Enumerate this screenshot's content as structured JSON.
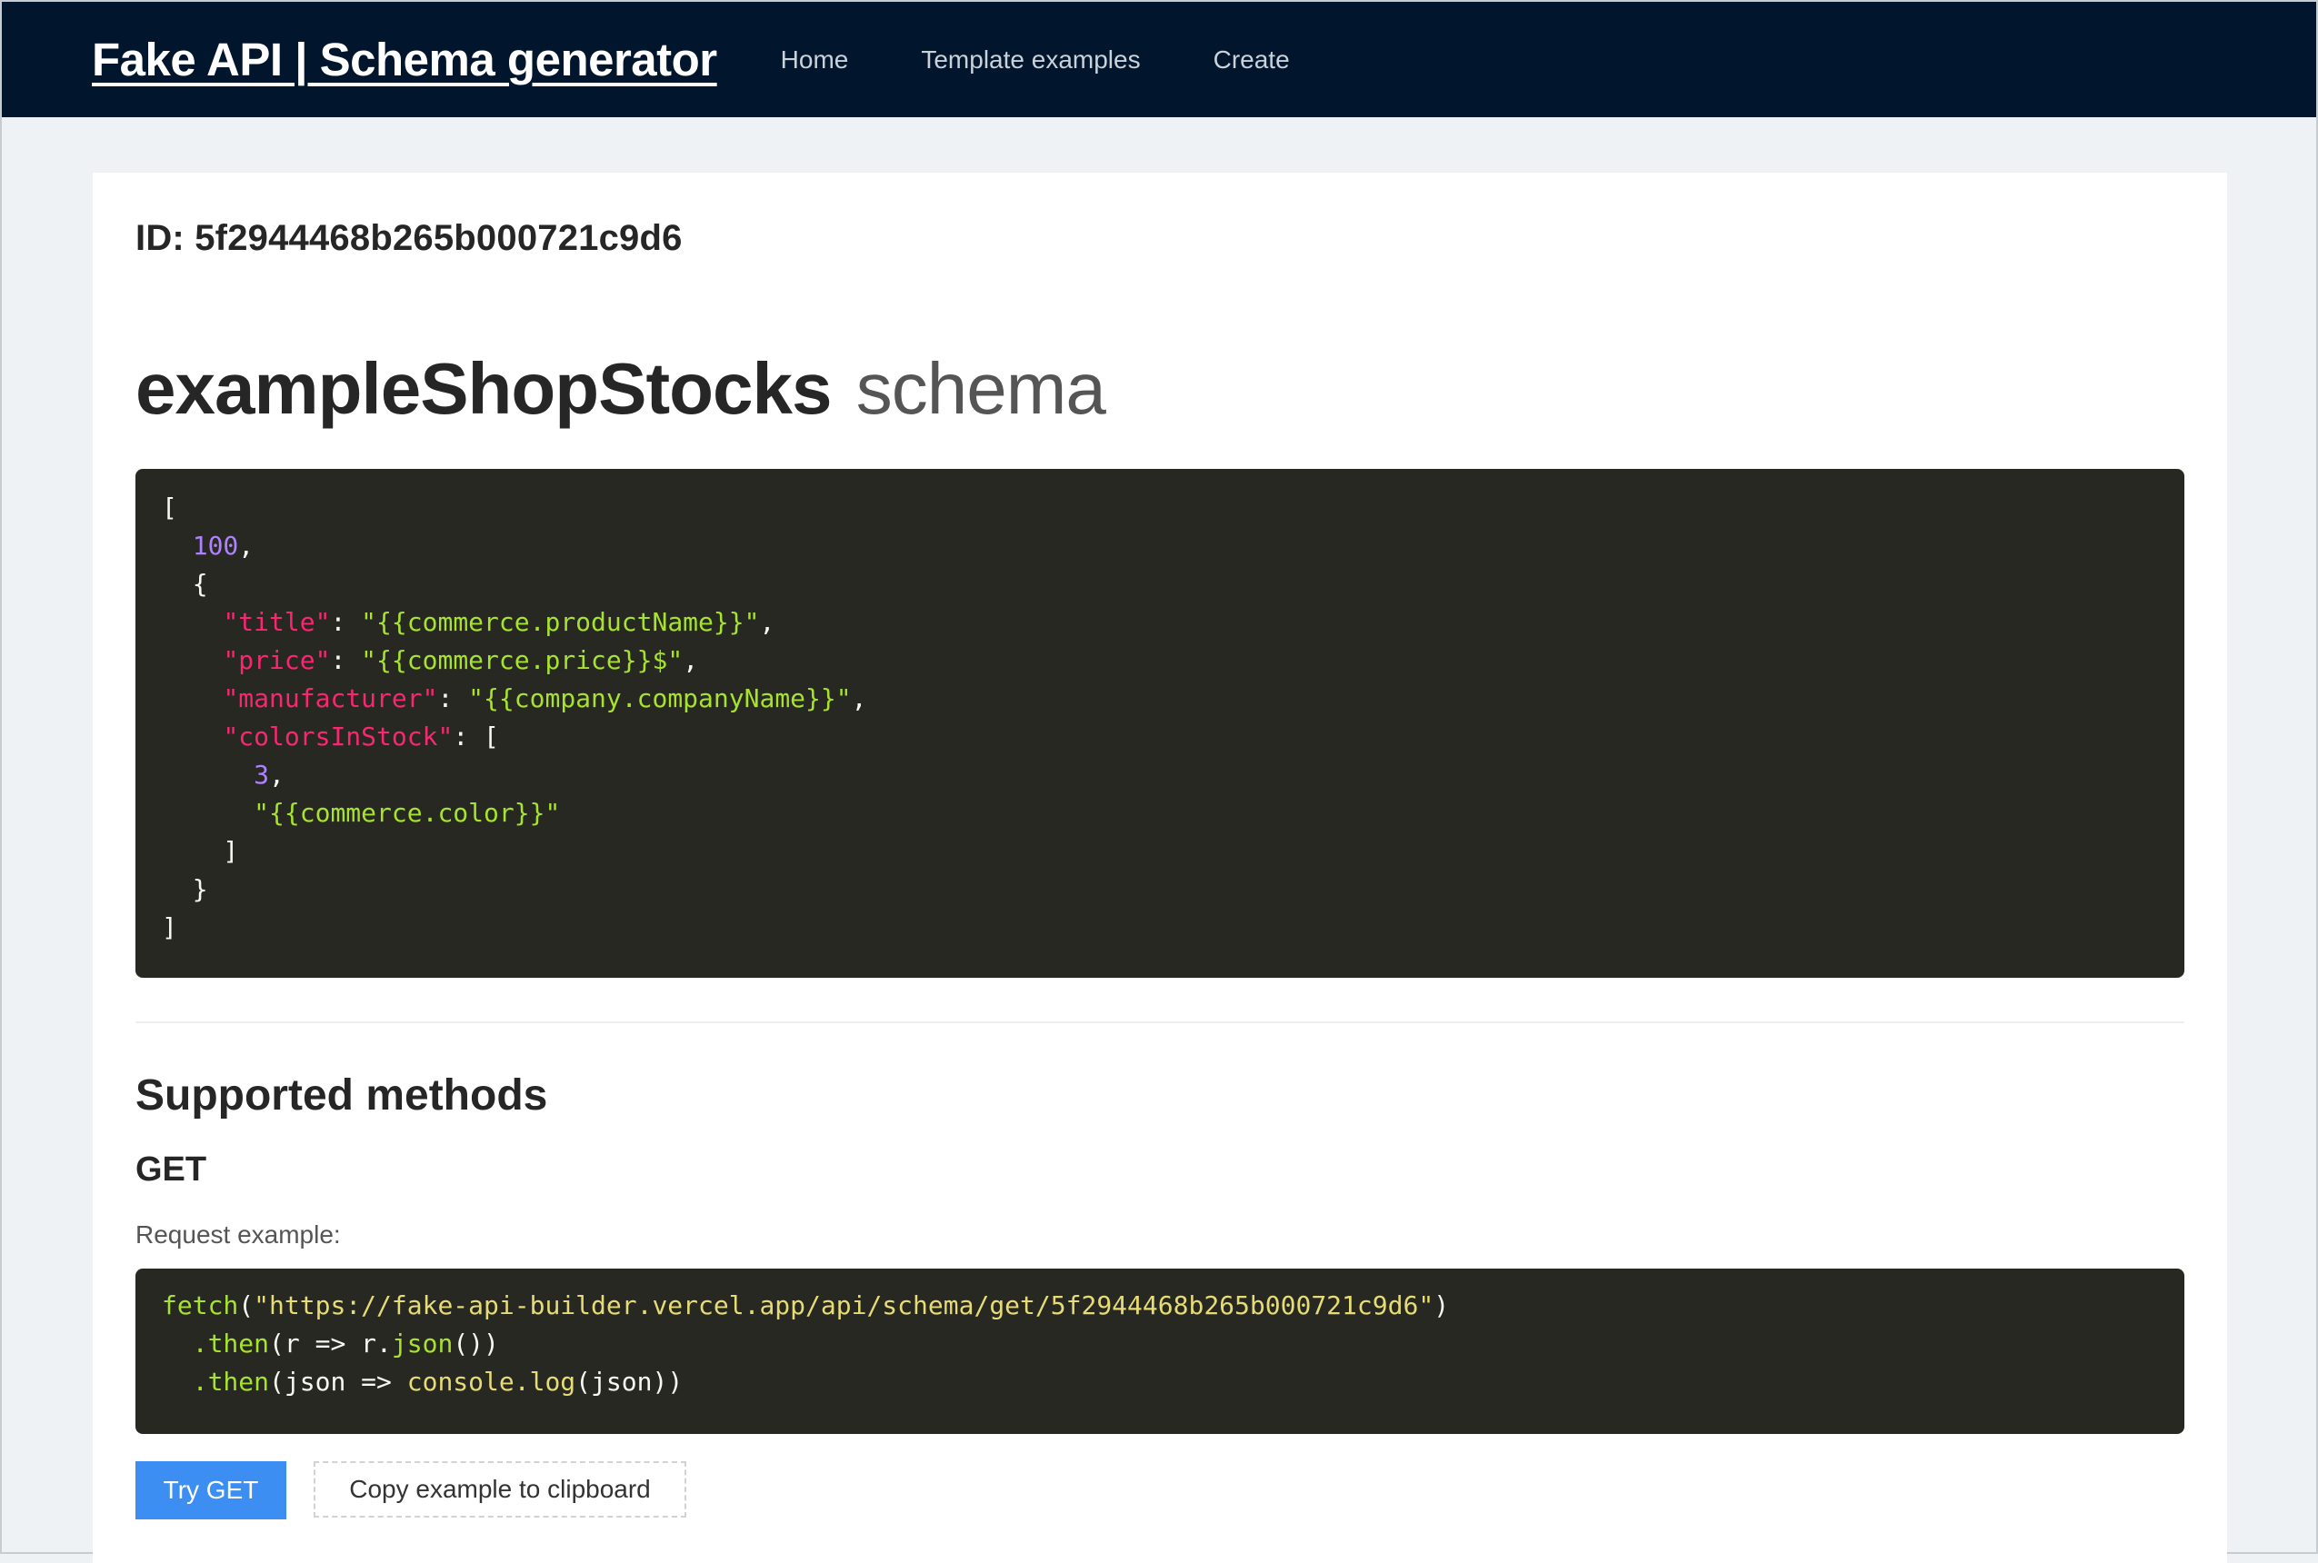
{
  "nav": {
    "brand": "Fake API | Schema generator",
    "links": [
      "Home",
      "Template examples",
      "Create"
    ]
  },
  "schema": {
    "id_line": "ID: 5f2944468b265b000721c9d6",
    "name": "exampleShopStocks",
    "suffix": "schema",
    "code": {
      "count": "100",
      "keys": {
        "title": "\"title\"",
        "price": "\"price\"",
        "manufacturer": "\"manufacturer\"",
        "colors": "\"colorsInStock\""
      },
      "values": {
        "title": "\"{{commerce.productName}}\"",
        "price": "\"{{commerce.price}}$\"",
        "manufacturer": "\"{{company.companyName}}\"",
        "colors_count": "3",
        "colors_item": "\"{{commerce.color}}\""
      }
    }
  },
  "methods": {
    "heading": "Supported methods",
    "get": {
      "heading": "GET",
      "request_label": "Request example:",
      "code": {
        "fetch": "fetch",
        "url": "\"https://fake-api-builder.vercel.app/api/schema/get/5f2944468b265b000721c9d6\"",
        "then1": ".then",
        "then1_args": "(r => r.",
        "json_fn": "json",
        "then1_tail": "())",
        "then2": ".then",
        "then2_args": "(json => ",
        "console_fn": "console.log",
        "then2_tail": "(json))"
      },
      "try_button": "Try GET",
      "copy_button": "Copy example to clipboard"
    }
  },
  "colors": {
    "navbar": "#01162c",
    "primary": "#3d8ef2",
    "code_bg": "#272822"
  }
}
